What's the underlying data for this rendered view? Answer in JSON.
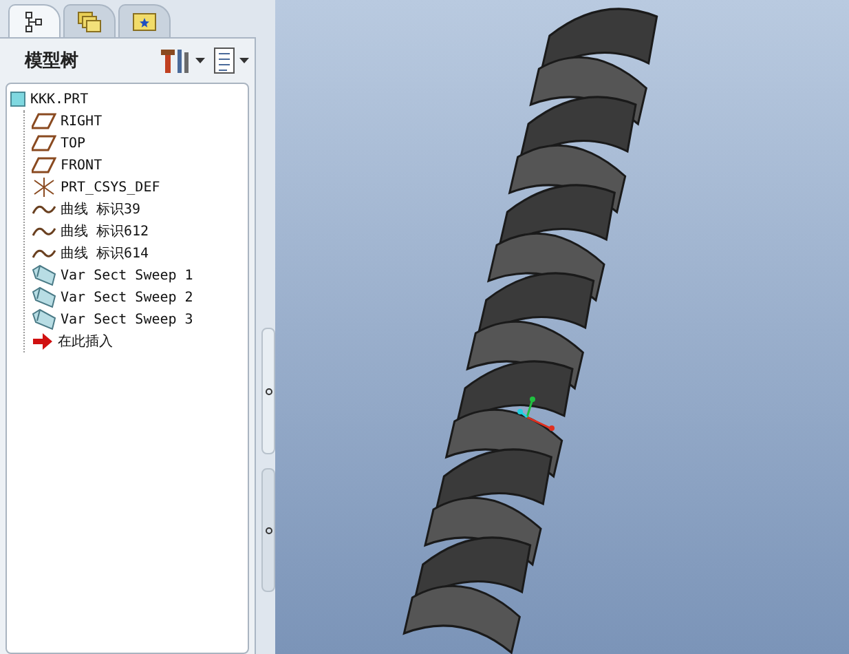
{
  "tabs": [
    {
      "kind": "tree",
      "selected": true
    },
    {
      "kind": "folders",
      "selected": false
    },
    {
      "kind": "favorites",
      "selected": false
    }
  ],
  "panel": {
    "title": "模型树"
  },
  "tree": {
    "label": "KKK.PRT",
    "kind": "part",
    "children": [
      {
        "label": "RIGHT",
        "kind": "plane"
      },
      {
        "label": "TOP",
        "kind": "plane"
      },
      {
        "label": "FRONT",
        "kind": "plane"
      },
      {
        "label": "PRT_CSYS_DEF",
        "kind": "csys"
      },
      {
        "label": "曲线 标识39",
        "kind": "curve"
      },
      {
        "label": "曲线 标识612",
        "kind": "curve"
      },
      {
        "label": "曲线 标识614",
        "kind": "curve"
      },
      {
        "label": "Var Sect Sweep 1",
        "kind": "sweep"
      },
      {
        "label": "Var Sect Sweep 2",
        "kind": "sweep"
      },
      {
        "label": "Var Sect Sweep 3",
        "kind": "sweep"
      },
      {
        "label": "在此插入",
        "kind": "insert"
      }
    ]
  }
}
